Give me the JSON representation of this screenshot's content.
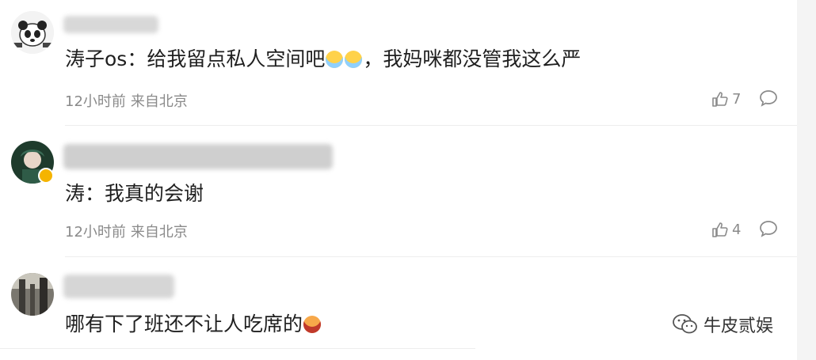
{
  "comments": [
    {
      "text_before": "涛子os：给我留点私人空间吧",
      "text_after": "，我妈咪都没管我这么严",
      "emojis": [
        "crying-emoji",
        "crying-emoji"
      ],
      "time": "12小时前",
      "location": "来自北京",
      "likes": "7"
    },
    {
      "text": "涛：我真的会谢",
      "time": "12小时前",
      "location": "来自北京",
      "likes": "4",
      "verified_badge_color": "#f5b400"
    },
    {
      "text": "哪有下了班还不让人吃席的",
      "emojis": [
        "wailing-emoji"
      ]
    }
  ],
  "watermark": {
    "text": "牛皮贰娱"
  },
  "colors": {
    "meta_text": "#8a8a8a",
    "divider": "#ededed"
  }
}
